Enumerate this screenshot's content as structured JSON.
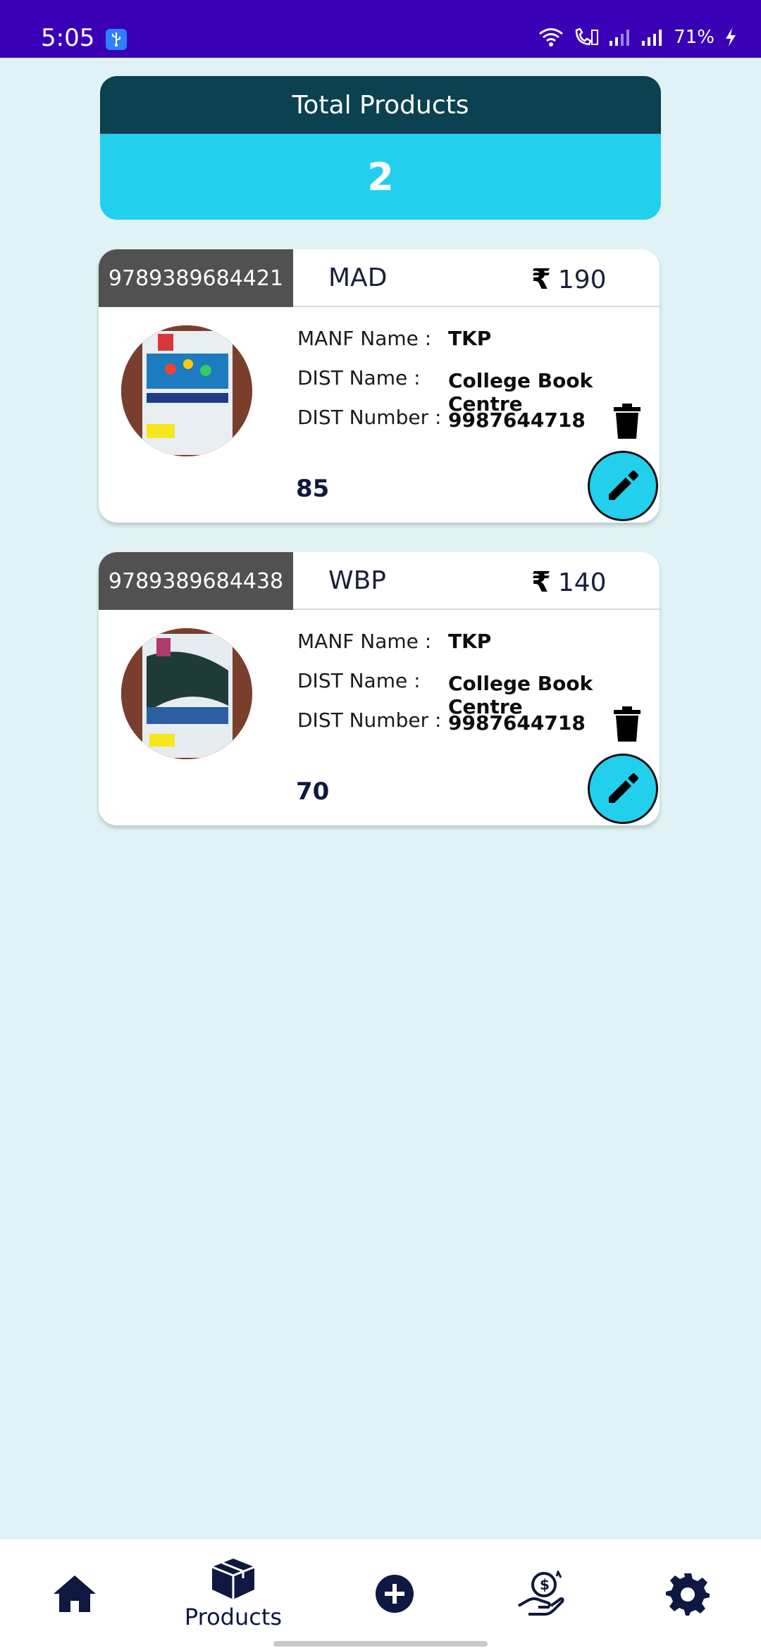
{
  "status_bar": {
    "time": "5:05",
    "battery": "71%",
    "icons": [
      "usb-icon",
      "wifi-icon",
      "wifi-calling-icon",
      "signal-icon",
      "signal-icon",
      "charging-icon"
    ]
  },
  "summary": {
    "title": "Total Products",
    "count": "2"
  },
  "products": [
    {
      "barcode": "9789389684421",
      "name": "MAD",
      "price": "190",
      "manf_label": "MANF Name :",
      "manf_value": "TKP",
      "dist_label": "DIST Name :",
      "dist_value": "College Book Centre",
      "dist_number_label": "DIST Number :",
      "dist_number_value": "9987644718",
      "quantity": "85"
    },
    {
      "barcode": "9789389684438",
      "name": "WBP",
      "price": "140",
      "manf_label": "MANF Name :",
      "manf_value": "TKP",
      "dist_label": "DIST Name :",
      "dist_value": "College Book Centre",
      "dist_number_label": "DIST Number :",
      "dist_number_value": "9987644718",
      "quantity": "70"
    }
  ],
  "bottom_nav": {
    "products_label": "Products",
    "items": [
      "home-icon",
      "products-icon",
      "add-icon",
      "sales-icon",
      "settings-icon"
    ]
  },
  "colors": {
    "status_bar": "#3a00b6",
    "header_dark": "#0b4150",
    "accent_cyan": "#22d0ee",
    "background": "#e0f2f5",
    "barcode_bg": "#515151",
    "nav_icon": "#0f1840"
  }
}
